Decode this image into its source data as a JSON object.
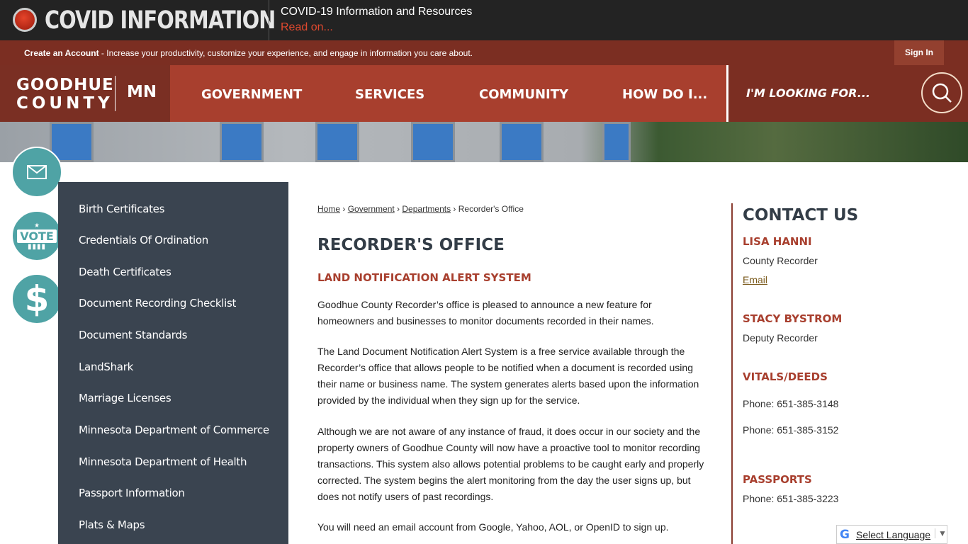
{
  "covid": {
    "title": "COVID INFORMATION",
    "headline": "COVID-19 Information and Resources",
    "link": "Read on..."
  },
  "account": {
    "bold": "Create an Account",
    "text": " - Increase your productivity, customize your experience, and engage in information you care about.",
    "signin": "Sign In"
  },
  "logo": {
    "line1": "GOODHUE",
    "line2": "COUNTY",
    "state": "MN"
  },
  "nav": [
    "GOVERNMENT",
    "SERVICES",
    "COMMUNITY",
    "HOW DO I..."
  ],
  "search": {
    "placeholder": "I'M LOOKING FOR..."
  },
  "quick_links": [
    {
      "icon": "envelope-icon"
    },
    {
      "icon": "vote-icon",
      "label": "VOTE"
    },
    {
      "icon": "dollar-icon",
      "label": "$"
    }
  ],
  "sidebar": [
    "Birth Certificates",
    "Credentials Of Ordination",
    "Death Certificates",
    "Document Recording Checklist",
    "Document Standards",
    "LandShark",
    "Marriage Licenses",
    "Minnesota Department of Commerce",
    "Minnesota Department of Health",
    "Passport Information",
    "Plats & Maps"
  ],
  "breadcrumb": [
    "Home",
    "Government",
    "Departments",
    "Recorder's Office"
  ],
  "main": {
    "title": "RECORDER'S OFFICE",
    "subtitle": "LAND NOTIFICATION ALERT SYSTEM",
    "paragraphs": [
      "Goodhue County Recorder’s office is pleased to announce a new feature for homeowners and businesses to monitor documents recorded in their names.",
      "The Land Document Notification Alert System is a free service available through the Recorder’s office that allows people to be notified when a document is recorded using their name or business name.  The system generates alerts based upon the information provided by the individual when they sign up for the service.",
      "Although we are not aware of any instance of fraud, it does occur in our society and the property owners of Goodhue County will now have a proactive tool to monitor recording transactions.  This system also allows potential problems to be caught early and properly corrected.  The system begins the alert monitoring from the day the user signs up, but does not notify users of past recordings.",
      "You will need an email account from Google, Yahoo, AOL, or OpenID to sign up."
    ]
  },
  "contact": {
    "title": "CONTACT US",
    "name1": "LISA HANNI",
    "role1": "County Recorder",
    "email": "Email",
    "name2": "STACY BYSTROM",
    "role2": "Deputy Recorder",
    "vitals": "VITALS/DEEDS",
    "phone1": "Phone: 651-385-3148",
    "phone2": "Phone: 651-385-3152",
    "passports": "PASSPORTS",
    "phone3": "Phone: 651-385-3223"
  },
  "translate": {
    "label": "Select Language"
  },
  "colors": {
    "accent": "#a83f2e",
    "dark_red": "#7b2e22",
    "sidebar": "#3a4450",
    "teal": "#4fa3a5"
  }
}
